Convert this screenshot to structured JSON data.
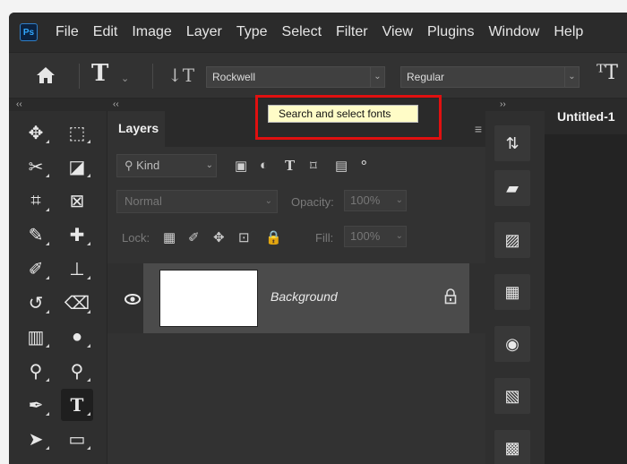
{
  "menubar": {
    "logo": "Ps",
    "items": [
      "File",
      "Edit",
      "Image",
      "Layer",
      "Type",
      "Select",
      "Filter",
      "View",
      "Plugins",
      "Window",
      "Help"
    ]
  },
  "options": {
    "tool_glyph": "T",
    "orient_glyph": "↓T",
    "font_family": "Rockwell",
    "font_style": "Regular",
    "size_glyph": "ᵀT"
  },
  "tooltip": {
    "text": "Search and select fonts"
  },
  "layers_panel": {
    "tab_label": "Layers",
    "kind_label": "Kind",
    "blend_mode": "Normal",
    "opacity_label": "Opacity:",
    "opacity_value": "100%",
    "lock_label": "Lock:",
    "fill_label": "Fill:",
    "fill_value": "100%",
    "layer_name": "Background"
  },
  "document": {
    "tab_title": "Untitled-1"
  },
  "colors": {
    "accent_highlight": "#e01010",
    "tooltip_bg": "#fffcc7"
  }
}
